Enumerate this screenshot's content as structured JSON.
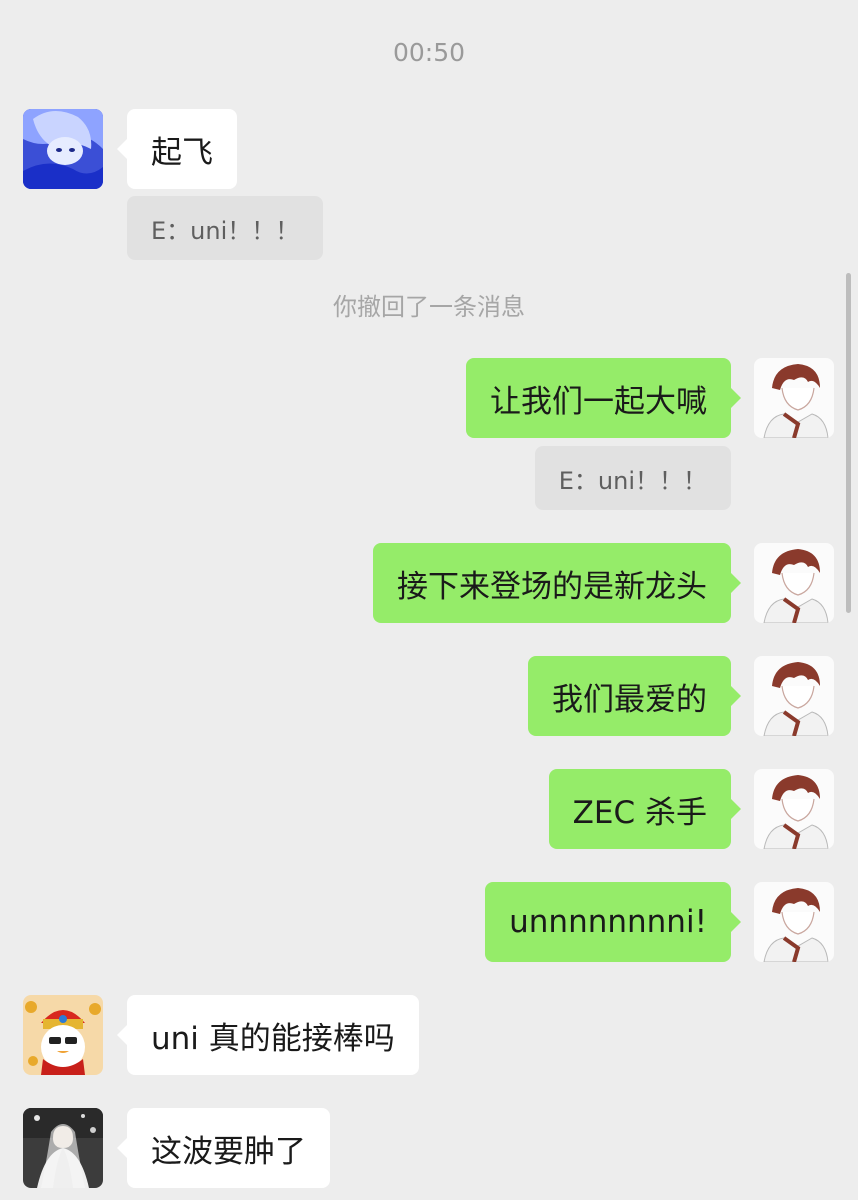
{
  "chat": {
    "timestamp": "00:50",
    "recall_notice": "你撤回了一条消息",
    "messages": [
      {
        "side": "in",
        "avatar": "blue-portrait-avatar",
        "text": "起飞",
        "quote": "E：uni！！！"
      },
      {
        "side": "out",
        "avatar": "sketch-boy-avatar",
        "text": "让我们一起大喊",
        "quote": "E：uni！！！"
      },
      {
        "side": "out",
        "avatar": "sketch-boy-avatar",
        "text": "接下来登场的是新龙头"
      },
      {
        "side": "out",
        "avatar": "sketch-boy-avatar",
        "text": "我们最爱的"
      },
      {
        "side": "out",
        "avatar": "sketch-boy-avatar",
        "text": "ZEC 杀手"
      },
      {
        "side": "out",
        "avatar": "sketch-boy-avatar",
        "text": "unnnnnnnni!"
      },
      {
        "side": "in",
        "avatar": "caishen-penguin-avatar",
        "text": "uni 真的能接棒吗"
      },
      {
        "side": "in",
        "avatar": "bride-photo-avatar",
        "text": "这波要肿了"
      }
    ]
  },
  "colors": {
    "background": "#ededed",
    "incoming_bubble": "#ffffff",
    "outgoing_bubble": "#95ec69",
    "quote_bubble": "#e1e1e1"
  }
}
